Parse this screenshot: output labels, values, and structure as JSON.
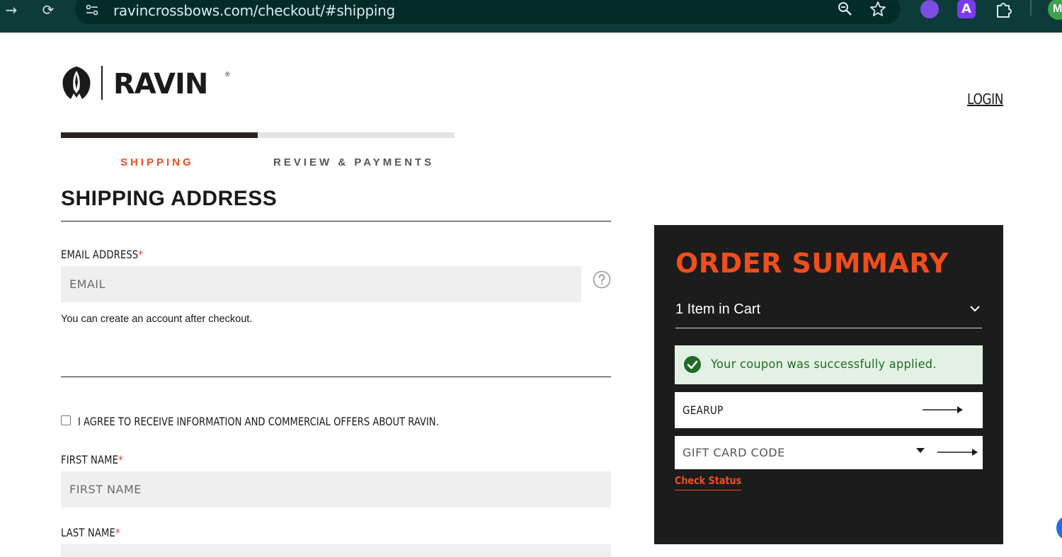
{
  "browser": {
    "url": "ravincrossbows.com/checkout/#shipping",
    "extension_a_label": "A",
    "profile_initial": "M"
  },
  "header": {
    "brand": "RAVIN",
    "registered_mark": "®",
    "login_label": "LOGIN"
  },
  "progress": {
    "fraction_complete": 0.5,
    "steps": [
      {
        "label": "SHIPPING",
        "active": true
      },
      {
        "label": "REVIEW & PAYMENTS",
        "active": false
      }
    ]
  },
  "shipping": {
    "title": "SHIPPING ADDRESS",
    "email": {
      "label": "EMAIL ADDRESS",
      "required_mark": "*",
      "placeholder": "EMAIL",
      "hint": "You can create an account after checkout."
    },
    "agree_label": "I AGREE TO RECEIVE INFORMATION AND COMMERCIAL OFFERS ABOUT RAVIN.",
    "agree_checked": false,
    "first_name": {
      "label": "FIRST NAME",
      "required_mark": "*",
      "placeholder": "FIRST NAME"
    },
    "last_name": {
      "label": "LAST NAME",
      "required_mark": "*",
      "placeholder": ""
    }
  },
  "summary": {
    "title": "ORDER SUMMARY",
    "cart_count_label": "1 Item in Cart",
    "coupon_message": "Your coupon was successfully applied.",
    "coupon_code": "GEARUP",
    "gift_card_placeholder": "GIFT CARD CODE",
    "check_status_label": "Check Status"
  },
  "colors": {
    "accent": "#f04e1a",
    "chrome_bg": "#0d3b3a",
    "summary_bg": "#1c1c1c",
    "success_bg": "#e3f1e4",
    "success_text": "#1f6b24",
    "input_bg": "#efefef",
    "progress_fill": "#2b241c"
  }
}
